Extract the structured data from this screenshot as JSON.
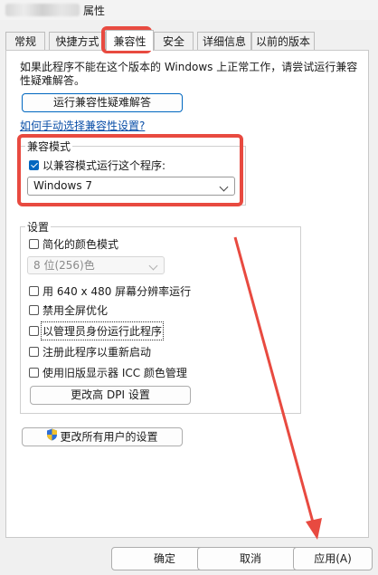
{
  "window": {
    "title": "属性"
  },
  "tabs": [
    {
      "label": "常规"
    },
    {
      "label": "快捷方式"
    },
    {
      "label": "兼容性"
    },
    {
      "label": "安全"
    },
    {
      "label": "详细信息"
    },
    {
      "label": "以前的版本"
    }
  ],
  "active_tab": "兼容性",
  "intro": {
    "text": "如果此程序不能在这个版本的 Windows 上正常工作，请尝试运行兼容性疑难解答。",
    "troubleshoot_button": "运行兼容性疑难解答",
    "manual_link": "如何手动选择兼容性设置?"
  },
  "compat_mode": {
    "group_label": "兼容模式",
    "checkbox_label": "以兼容模式运行这个程序:",
    "checked": true,
    "selected_os": "Windows 7"
  },
  "settings": {
    "group_label": "设置",
    "reduced_color": {
      "label": "简化的颜色模式",
      "checked": false
    },
    "color_depth": "8 位(256)色",
    "res_640": {
      "label": "用 640 x 480 屏幕分辨率运行",
      "checked": false
    },
    "disable_fullscreen": {
      "label": "禁用全屏优化",
      "checked": false
    },
    "run_as_admin": {
      "label": "以管理员身份运行此程序",
      "checked": false
    },
    "register_restart": {
      "label": "注册此程序以重新启动",
      "checked": false
    },
    "legacy_icc": {
      "label": "使用旧版显示器 ICC 颜色管理",
      "checked": false
    },
    "dpi_button": "更改高 DPI 设置"
  },
  "all_users_button": "更改所有用户的设置",
  "footer": {
    "ok": "确定",
    "cancel": "取消",
    "apply": "应用(A)"
  },
  "colors": {
    "annotation": "#e84a40",
    "accent": "#0067c0",
    "link": "#0a4fa8"
  }
}
